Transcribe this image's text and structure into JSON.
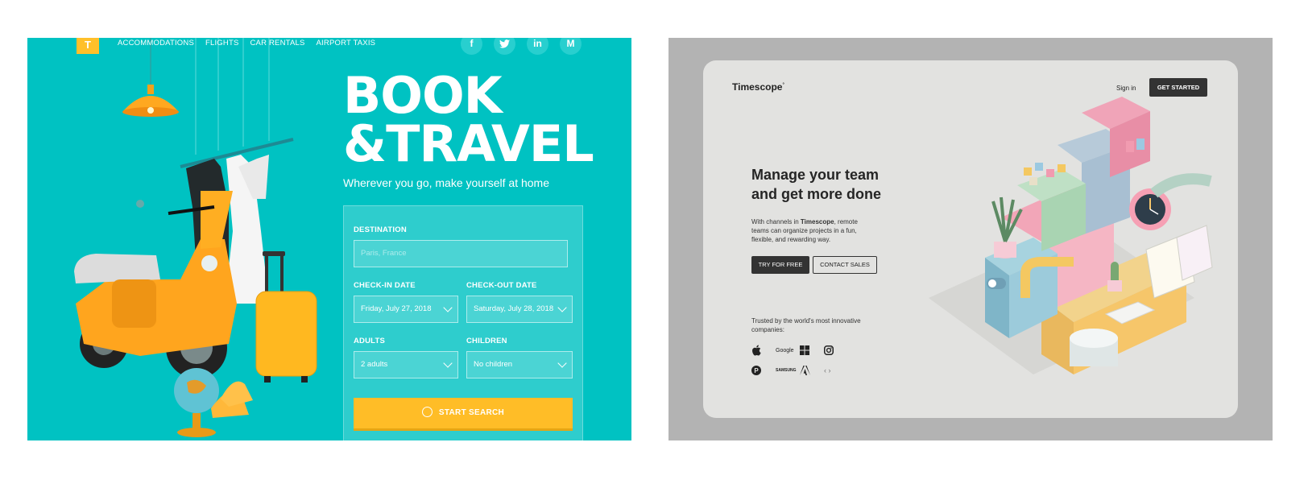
{
  "travel": {
    "logo_letter": "T",
    "nav": [
      "ACCOMMODATIONS",
      "FLIGHTS",
      "CAR RENTALS",
      "AIRPORT TAXIS"
    ],
    "social": [
      {
        "icon": "facebook-icon",
        "glyph": "f"
      },
      {
        "icon": "twitter-icon",
        "glyph": "t"
      },
      {
        "icon": "linkedin-icon",
        "glyph": "in"
      },
      {
        "icon": "medium-icon",
        "glyph": "M"
      }
    ],
    "title": "BOOK\n&TRAVEL",
    "subtitle": "Wherever you go, make yourself at home",
    "form": {
      "destination_label": "DESTINATION",
      "destination_placeholder": "Paris, France",
      "checkin_label": "CHECK-IN DATE",
      "checkin_value": "Friday, July 27, 2018",
      "checkout_label": "CHECK-OUT DATE",
      "checkout_value": "Saturday, July 28, 2018",
      "adults_label": "ADULTS",
      "adults_value": "2 adults",
      "children_label": "CHILDREN",
      "children_value": "No children",
      "search_button": "START SEARCH"
    },
    "colors": {
      "background": "#00c2c2",
      "accent": "#ffbd27"
    }
  },
  "timescope": {
    "brand": "Timescope",
    "brand_mark": "°",
    "signin": "Sign in",
    "get_started": "GET STARTED",
    "headline": "Manage your team\nand get more done",
    "desc_before": "With channels in ",
    "desc_brand": "Timescope",
    "desc_after": ", remote teams can organize projects in a fun, flexible, and rewarding way.",
    "try_button": "TRY FOR FREE",
    "contact_button": "CONTACT SALES",
    "trusted_text": "Trusted by the world's most innovative companies:",
    "logos_row1": [
      {
        "name": "apple-logo",
        "label": ""
      },
      {
        "name": "google-logo",
        "label": "Google"
      },
      {
        "name": "windows-logo",
        "label": ""
      },
      {
        "name": "instagram-logo",
        "label": ""
      }
    ],
    "logos_row2": [
      {
        "name": "pinterest-logo",
        "label": ""
      },
      {
        "name": "samsung-logo",
        "label": "SAMSUNG"
      },
      {
        "name": "adobe-logo",
        "label": ""
      }
    ],
    "nav_arrows": "‹ ›",
    "colors": {
      "frame": "#b3b3b3",
      "card": "#e2e2e0",
      "button": "#333333"
    }
  }
}
